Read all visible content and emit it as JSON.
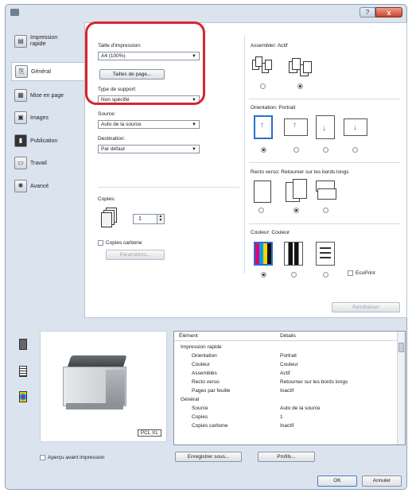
{
  "window": {
    "help_label": "?",
    "close_label": "x"
  },
  "sidebar": {
    "items": [
      {
        "label": "Impression rapide",
        "icon": "printer-icon"
      },
      {
        "label": "Général",
        "icon": "general-icon"
      },
      {
        "label": "Mise en page",
        "icon": "layout-icon"
      },
      {
        "label": "Images",
        "icon": "images-icon"
      },
      {
        "label": "Publication",
        "icon": "publication-icon"
      },
      {
        "label": "Travail",
        "icon": "job-icon"
      },
      {
        "label": "Avancé",
        "icon": "advanced-icon"
      }
    ]
  },
  "general": {
    "paper_size_label": "Taille d'impression:",
    "paper_size_value": "A4 (100%)",
    "page_sizes_button": "Tailles de page...",
    "media_type_label": "Type de support:",
    "media_type_value": "Non spécifié",
    "source_label": "Source:",
    "source_value": "Auto de la source",
    "destination_label": "Destination:",
    "destination_value": "Par défaut",
    "copies_label": "Copies:",
    "copies_value": "1",
    "carbon_copies_label": "Copies carbone",
    "parameters_button": "Paramètres...",
    "collate_label": "Assembler: Actif",
    "orientation_label": "Orientation: Portrait",
    "duplex_label": "Recto verso: Retourner sur les bords longs",
    "color_label": "Couleur: Couleur",
    "ecoprint_label": "EcoPrint",
    "reset_button": "Réinitialiser"
  },
  "bottom": {
    "pcl_badge": "PCL XL",
    "details_header": {
      "element": "Élément",
      "details": "Détails"
    },
    "details_rows": [
      {
        "k": "Impression rapide",
        "v": "",
        "group": true
      },
      {
        "k": "Orientation",
        "v": "Portrait"
      },
      {
        "k": "Couleur",
        "v": "Couleur"
      },
      {
        "k": "Assemblés",
        "v": "Actif"
      },
      {
        "k": "Recto verso",
        "v": "Retourner sur les bords longs"
      },
      {
        "k": "Pages par feuille",
        "v": "Inactif"
      },
      {
        "k": "Général",
        "v": "",
        "group": true
      },
      {
        "k": "Source",
        "v": "Auto de la source"
      },
      {
        "k": "Copies",
        "v": "1"
      },
      {
        "k": "Copies carbone",
        "v": "Inactif"
      }
    ],
    "preview_check_label": "Aperçu avant impression",
    "save_button": "Enregistrer sous...",
    "profiles_button": "Profils..."
  },
  "footer": {
    "ok_button": "OK",
    "cancel_button": "Annuler"
  }
}
